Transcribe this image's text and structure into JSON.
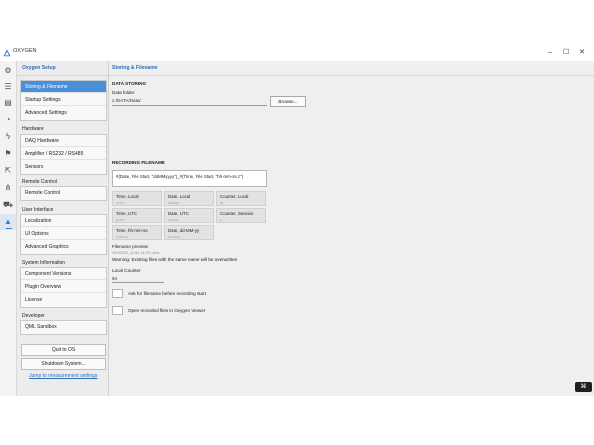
{
  "app": {
    "title": "OXYGEN"
  },
  "window_controls": {
    "minimize": "–",
    "maximize": "☐",
    "close": "✕"
  },
  "icon_rail": {
    "items": [
      {
        "name": "gear-icon",
        "glyph": "⚙"
      },
      {
        "name": "list-icon",
        "glyph": "☰"
      },
      {
        "name": "document-icon",
        "glyph": "▤"
      },
      {
        "name": "gauge-icon",
        "glyph": "◔"
      },
      {
        "name": "bolt-icon",
        "glyph": "ϟ"
      },
      {
        "name": "flag-icon",
        "glyph": "⚑"
      },
      {
        "name": "export-icon",
        "glyph": "⇱"
      },
      {
        "name": "network-icon",
        "glyph": "⋔"
      },
      {
        "name": "car-icon",
        "glyph": "⛟"
      },
      {
        "name": "oxygen-logo-icon",
        "glyph": "▲"
      }
    ],
    "active_index": 9
  },
  "sidebar": {
    "title": "Oxygen Setup",
    "groups": [
      {
        "title": "",
        "items": [
          "Storing & Filename",
          "Startup Settings",
          "Advanced Settings"
        ]
      },
      {
        "title": "Hardware",
        "items": [
          "DAQ Hardware",
          "Amplifier / RS232 / RS485",
          "Sensors"
        ]
      },
      {
        "title": "Remote Control",
        "items": [
          "Remote Control"
        ]
      },
      {
        "title": "User Interface",
        "items": [
          "Localization",
          "UI Options",
          "Advanced Graphics"
        ]
      },
      {
        "title": "System Information",
        "items": [
          "Component Versions",
          "Plugin Overview",
          "License"
        ]
      },
      {
        "title": "Developer",
        "items": [
          "QML Sandbox"
        ]
      }
    ],
    "selected_item": "Storing & Filename",
    "quit_button": "Quit to OS",
    "shutdown_button": "Shutdown System...",
    "jump_link": "Jump to measurement settings"
  },
  "content": {
    "title": "Storing & Filename",
    "data_storing": {
      "heading": "DATA STORING",
      "folder_label": "Data folder",
      "folder_value": "c:/DATA/Data/",
      "browse_button": "Browse..."
    },
    "recorded_filename": {
      "heading": "RECORDING FILENAME",
      "pattern": "#(Date, File Start, \"ddMMyyyy\")_#(Time, File Start, \"hh-mm-ss.z\")",
      "tokens": [
        {
          "name": "Time, Local",
          "example": "12:50"
        },
        {
          "name": "Date, Local",
          "example": "10/2022"
        },
        {
          "name": "Counter, Local",
          "example": "94"
        },
        {
          "name": "Time, UTC",
          "example": "10:50"
        },
        {
          "name": "Date, UTC",
          "example": "10/2022"
        },
        {
          "name": "Counter, Session",
          "example": "1"
        },
        {
          "name": "Time, hh-mm-ss",
          "example": "12-50-14"
        },
        {
          "name": "Date, dd-MM-yy",
          "example": "19-10-22"
        }
      ],
      "preview_label": "Filename preview",
      "preview_value": "19102022_12-50-14.297.dmd",
      "warning": "Warning: Existing files with the same name will be overwritten",
      "counter_label": "Local Counter",
      "counter_value": "94"
    },
    "options": [
      {
        "label": "Ask for filename before recording start",
        "checked": false
      },
      {
        "label": "Open recorded files in Oxygen Viewer",
        "checked": false
      }
    ]
  },
  "corner_badge": "⌘"
}
